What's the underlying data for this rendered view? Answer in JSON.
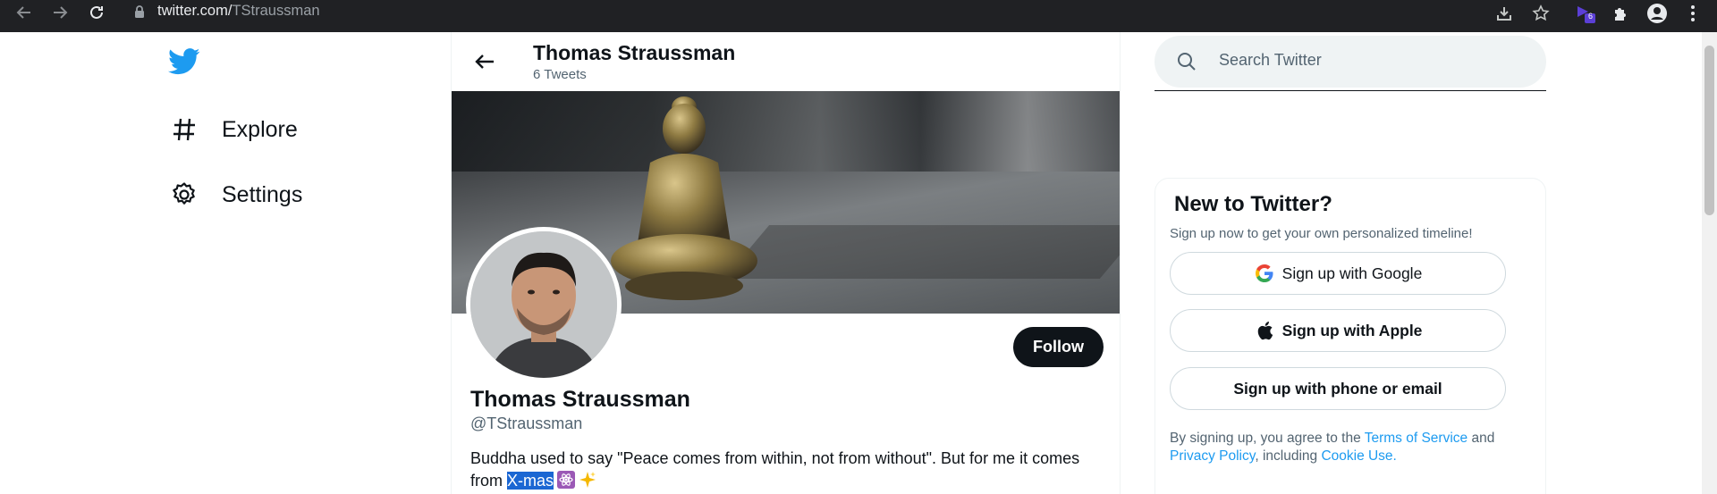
{
  "browser": {
    "url_host": "twitter.com/",
    "url_path": "TStraussman",
    "extension_badge": "6"
  },
  "nav": {
    "items": [
      {
        "label": "Explore",
        "icon": "hashtag-icon"
      },
      {
        "label": "Settings",
        "icon": "gear-icon"
      }
    ]
  },
  "header": {
    "name": "Thomas Straussman",
    "tweet_count": "6 Tweets"
  },
  "profile": {
    "name": "Thomas Straussman",
    "handle": "@TStraussman",
    "follow_label": "Follow",
    "bio_text": "Buddha used to say \"Peace comes from within, not from without\". But for me it comes from ",
    "bio_selected": "X-mas"
  },
  "search": {
    "placeholder": "Search Twitter"
  },
  "signup": {
    "title": "New to Twitter?",
    "subtitle": "Sign up now to get your own personalized timeline!",
    "google_label": "Sign up with Google",
    "apple_label": "Sign up with Apple",
    "phone_label": "Sign up with phone or email",
    "legal_prefix": "By signing up, you agree to the ",
    "terms_link": "Terms of Service",
    "legal_and": " and",
    "privacy_link": "Privacy Policy",
    "legal_including": ", including ",
    "cookie_link": "Cookie Use."
  },
  "colors": {
    "brand": "#1d9bf0",
    "text": "#0f1419",
    "secondary": "#536471",
    "selection": "#1b67d3"
  }
}
